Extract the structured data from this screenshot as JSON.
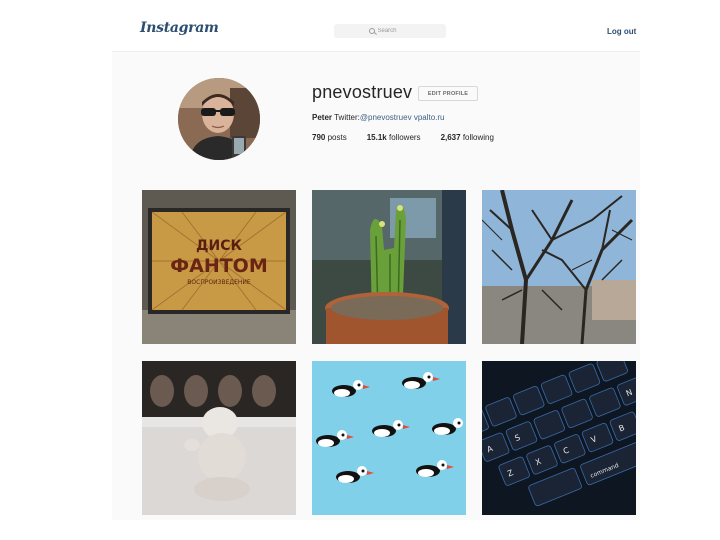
{
  "header": {
    "logo": "Instagram",
    "search_placeholder": "Search",
    "logout_label": "Log out"
  },
  "profile": {
    "username": "pnevostruev",
    "edit_profile_label": "EDIT PROFILE",
    "bio_name": "Peter",
    "bio_text": "Twitter:",
    "bio_handle": "@pnevostruev",
    "bio_link": "vpalto.ru",
    "posts_count": "790",
    "posts_label": "posts",
    "followers_count": "15.1k",
    "followers_label": "followers",
    "following_count": "2,637",
    "following_label": "following"
  },
  "photos": {
    "tile1_sign_line1": "ДИСК",
    "tile1_sign_line2": "ФАНТОМ",
    "tile1_sign_line3": "ВОСПРОИЗВЕДЕНИЕ",
    "tile6_keys": [
      "A",
      "S",
      "Z",
      "X",
      "C",
      "V",
      "B",
      "N",
      "command"
    ]
  },
  "colors": {
    "link": "#3f5f85",
    "logo": "#2c4e70",
    "page_bg": "#fafafa"
  }
}
